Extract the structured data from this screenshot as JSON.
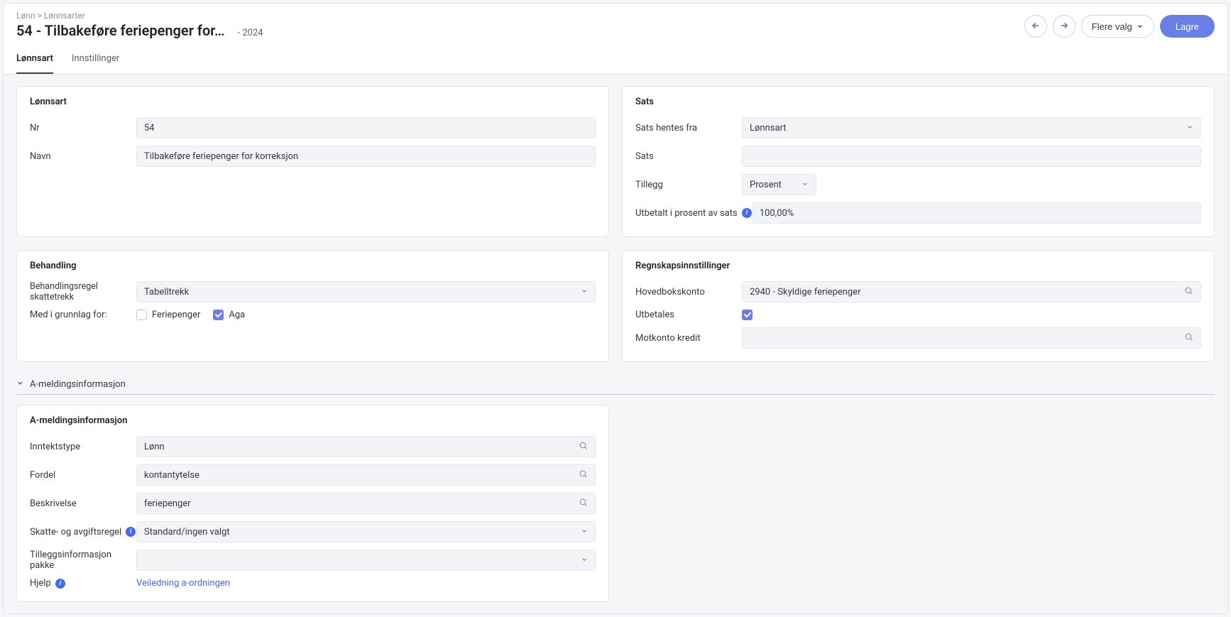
{
  "breadcrumb": "Lønn > Lønnsarter",
  "title": "54 - Tilbakeføre feriepenger for…",
  "year": "- 2024",
  "buttons": {
    "more": "Flere valg",
    "save": "Lagre"
  },
  "tabs": {
    "lonnsart": "Lønnsart",
    "innstillinger": "Innstillinger"
  },
  "cards": {
    "lonnsart": {
      "title": "Lønnsart",
      "nr_label": "Nr",
      "nr_value": "54",
      "navn_label": "Navn",
      "navn_value": "Tilbakeføre feriepenger for korreksjon"
    },
    "sats": {
      "title": "Sats",
      "hentes_label": "Sats hentes fra",
      "hentes_value": "Lønnsart",
      "sats_label": "Sats",
      "sats_value": "",
      "tillegg_label": "Tillegg",
      "tillegg_value": "Prosent",
      "utbetalt_label": "Utbetalt i prosent av sats",
      "utbetalt_value": "100,00%"
    },
    "behandling": {
      "title": "Behandling",
      "regel_label": "Behandlingsregel skattetrekk",
      "regel_value": "Tabelltrekk",
      "grunnlag_label": "Med i grunnlag for:",
      "feriepenger": "Feriepenger",
      "aga": "Aga"
    },
    "regnskap": {
      "title": "Regnskapsinnstillinger",
      "hovedbok_label": "Hovedbokskonto",
      "hovedbok_value": "2940 - Skyldige feriepenger",
      "utbetales_label": "Utbetales",
      "motkonto_label": "Motkonto kredit",
      "motkonto_value": ""
    },
    "amelding": {
      "section_title": "A-meldingsinformasjon",
      "title": "A-meldingsinformasjon",
      "inntektstype_label": "Inntektstype",
      "inntektstype_value": "Lønn",
      "fordel_label": "Fordel",
      "fordel_value": "kontantytelse",
      "beskrivelse_label": "Beskrivelse",
      "beskrivelse_value": "feriepenger",
      "skatte_label": "Skatte- og avgiftsregel",
      "skatte_value": "Standard/ingen valgt",
      "tillegg_label": "Tilleggsinformasjon pakke",
      "tillegg_value": "",
      "hjelp_label": "Hjelp",
      "hjelp_link": "Veiledning a-ordningen"
    }
  }
}
